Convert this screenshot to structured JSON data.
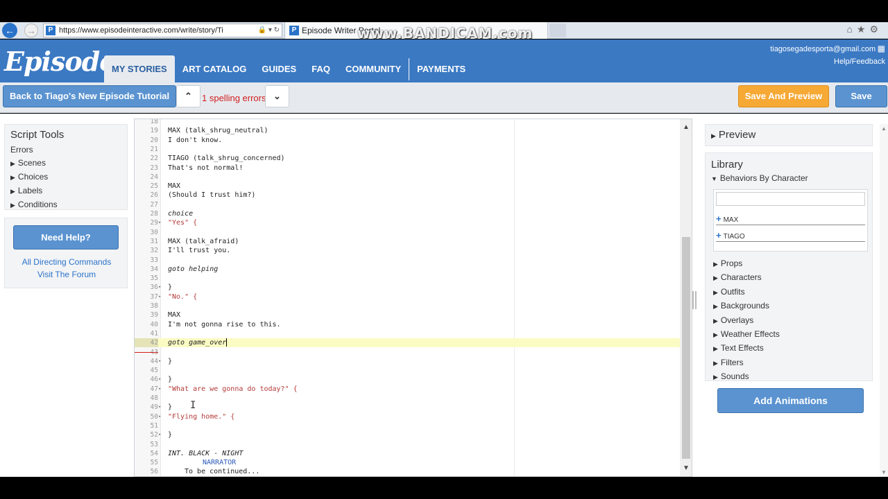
{
  "browser": {
    "url": "https://www.episodeinteractive.com/write/story/Ti",
    "tab_title": "Episode Writer Portal",
    "watermark": "www.BANDICAM.com"
  },
  "header": {
    "logo": "Episode",
    "nav": [
      "MY STORIES",
      "ART CATALOG",
      "GUIDES",
      "FAQ",
      "COMMUNITY",
      "PAYMENTS"
    ],
    "active_nav": "MY STORIES",
    "user_email": "tiagosegadesporta@gmail.com",
    "help_link": "Help/Feedback"
  },
  "toolbar": {
    "back_label": "Back to Tiago's New Episode Tutorial",
    "up_label": "⬆",
    "down_label": "⬇",
    "spelling_errors": "1 spelling errors",
    "save_preview_label": "Save And Preview",
    "save_label": "Save"
  },
  "script_tools": {
    "title": "Script Tools",
    "errors_label": "Errors",
    "items": [
      "Scenes",
      "Choices",
      "Labels",
      "Conditions"
    ]
  },
  "help": {
    "need_help_label": "Need Help?",
    "links": [
      "All Directing Commands",
      "Visit The Forum"
    ]
  },
  "editor": {
    "current_line": 42,
    "lines": [
      {
        "n": "18",
        "text": ""
      },
      {
        "n": "19",
        "text": "MAX (talk_shrug_neutral)"
      },
      {
        "n": "20",
        "text": "I don't know."
      },
      {
        "n": "21",
        "text": ""
      },
      {
        "n": "22",
        "text": "TIAGO (talk_shrug_concerned)"
      },
      {
        "n": "23",
        "text": "That's not normal!"
      },
      {
        "n": "24",
        "text": ""
      },
      {
        "n": "25",
        "text": "MAX"
      },
      {
        "n": "26",
        "text": "(Should I trust him?)"
      },
      {
        "n": "27",
        "text": ""
      },
      {
        "n": "28",
        "text": "choice"
      },
      {
        "n": "29",
        "text": "\"Yes\" {"
      },
      {
        "n": "30",
        "text": ""
      },
      {
        "n": "31",
        "text": "MAX (talk_afraid)"
      },
      {
        "n": "32",
        "text": "I'll trust you."
      },
      {
        "n": "33",
        "text": ""
      },
      {
        "n": "34",
        "text": "goto helping"
      },
      {
        "n": "35",
        "text": ""
      },
      {
        "n": "36",
        "text": "}"
      },
      {
        "n": "37",
        "text": "\"No.\" {"
      },
      {
        "n": "38",
        "text": ""
      },
      {
        "n": "39",
        "text": "MAX"
      },
      {
        "n": "40",
        "text": "I'm not gonna rise to this."
      },
      {
        "n": "41",
        "text": ""
      },
      {
        "n": "42",
        "text": "goto game_over"
      },
      {
        "n": "43",
        "text": ""
      },
      {
        "n": "44",
        "text": "}"
      },
      {
        "n": "45",
        "text": ""
      },
      {
        "n": "46",
        "text": "}"
      },
      {
        "n": "47",
        "text": "\"What are we gonna do today?\" {"
      },
      {
        "n": "48",
        "text": ""
      },
      {
        "n": "49",
        "text": "}"
      },
      {
        "n": "50",
        "text": "\"Flying home.\" {"
      },
      {
        "n": "51",
        "text": ""
      },
      {
        "n": "52",
        "text": "}"
      },
      {
        "n": "53",
        "text": ""
      },
      {
        "n": "54",
        "text": "INT. BLACK - NIGHT"
      },
      {
        "n": "55",
        "text": "NARRATOR"
      },
      {
        "n": "56",
        "text": "To be continued..."
      }
    ]
  },
  "preview": {
    "label": "Preview"
  },
  "library": {
    "title": "Library",
    "behaviors_label": "Behaviors By Character",
    "search_placeholder": "",
    "characters": [
      "MAX",
      "TIAGO"
    ],
    "items": [
      "Props",
      "Characters",
      "Outfits",
      "Backgrounds",
      "Overlays",
      "Weather Effects",
      "Text Effects",
      "Filters",
      "Sounds"
    ],
    "add_animations_label": "Add Animations"
  }
}
